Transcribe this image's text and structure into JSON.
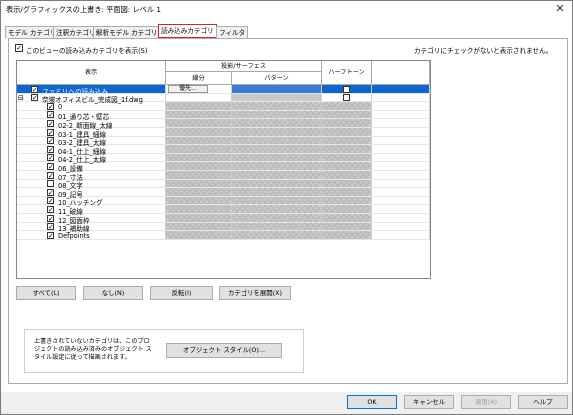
{
  "window": {
    "title": "表示/グラフィックスの上書き: 平面図: レベル 1",
    "close_glyph": "✕"
  },
  "tabs": [
    {
      "label": "モデル カテゴリ",
      "active": false
    },
    {
      "label": "注釈カテゴリ",
      "active": false
    },
    {
      "label": "解析モデル カテゴリ",
      "active": false
    },
    {
      "label": "読み込みカテゴリ",
      "active": true
    },
    {
      "label": "フィルタ",
      "active": false
    }
  ],
  "show_checkbox": {
    "label": "このビューの読み込みカテゴリを表示(S)",
    "checked": true
  },
  "hint_text": "カテゴリにチェックがないと表示されません。",
  "table": {
    "col_display": "表示",
    "col_projection": "投影/サーフェス",
    "col_line": "線分",
    "col_pattern": "パターン",
    "col_halftone": "ハーフトーン",
    "override_button": "優先...",
    "rows": [
      {
        "label": "ファミリへの読み込み",
        "checked": true,
        "level": 0,
        "expander": "",
        "selected": true,
        "halftone": false
      },
      {
        "label": "奈坡オフィスビル_完成図_1f.dwg",
        "checked": true,
        "level": 0,
        "expander": "⊟",
        "selected": false,
        "halftone": false
      },
      {
        "label": "0",
        "checked": true,
        "level": 1,
        "selected": false
      },
      {
        "label": "01_通り芯・壁芯",
        "checked": true,
        "level": 1,
        "selected": false
      },
      {
        "label": "02-2_断面線_太線",
        "checked": true,
        "level": 1,
        "selected": false
      },
      {
        "label": "03-1_建具_細線",
        "checked": true,
        "level": 1,
        "selected": false
      },
      {
        "label": "03-2_建具_太線",
        "checked": true,
        "level": 1,
        "selected": false
      },
      {
        "label": "04-1_仕上_細線",
        "checked": true,
        "level": 1,
        "selected": false
      },
      {
        "label": "04-2_仕上_太線",
        "checked": true,
        "level": 1,
        "selected": false
      },
      {
        "label": "06_設備",
        "checked": true,
        "level": 1,
        "selected": false
      },
      {
        "label": "07_寸法",
        "checked": true,
        "level": 1,
        "selected": false
      },
      {
        "label": "08_文字",
        "checked": false,
        "level": 1,
        "selected": false
      },
      {
        "label": "09_記号",
        "checked": true,
        "level": 1,
        "selected": false
      },
      {
        "label": "10_ハッチング",
        "checked": true,
        "level": 1,
        "selected": false
      },
      {
        "label": "11_破線",
        "checked": true,
        "level": 1,
        "selected": false
      },
      {
        "label": "12_図面枠",
        "checked": true,
        "level": 1,
        "selected": false
      },
      {
        "label": "13_補助線",
        "checked": true,
        "level": 1,
        "selected": false
      },
      {
        "label": "Defpoints",
        "checked": true,
        "level": 1,
        "selected": false
      }
    ]
  },
  "buttons": {
    "all": "すべて(L)",
    "none": "なし(N)",
    "invert": "反転(I)",
    "expand": "カテゴリを展開(X)",
    "object_styles": "オブジェクト スタイル(O)...",
    "ok": "OK",
    "cancel": "キャンセル",
    "apply": "適用(A)",
    "help": "ヘルプ"
  },
  "note_text": "上書きされていないカテゴリは、このプロジェクトの読み込み済みのオブジェクト スタイル設定に従って描画されます。",
  "colors": {
    "selection": "#0c67d3",
    "active_tab_border": "#e0201d"
  }
}
